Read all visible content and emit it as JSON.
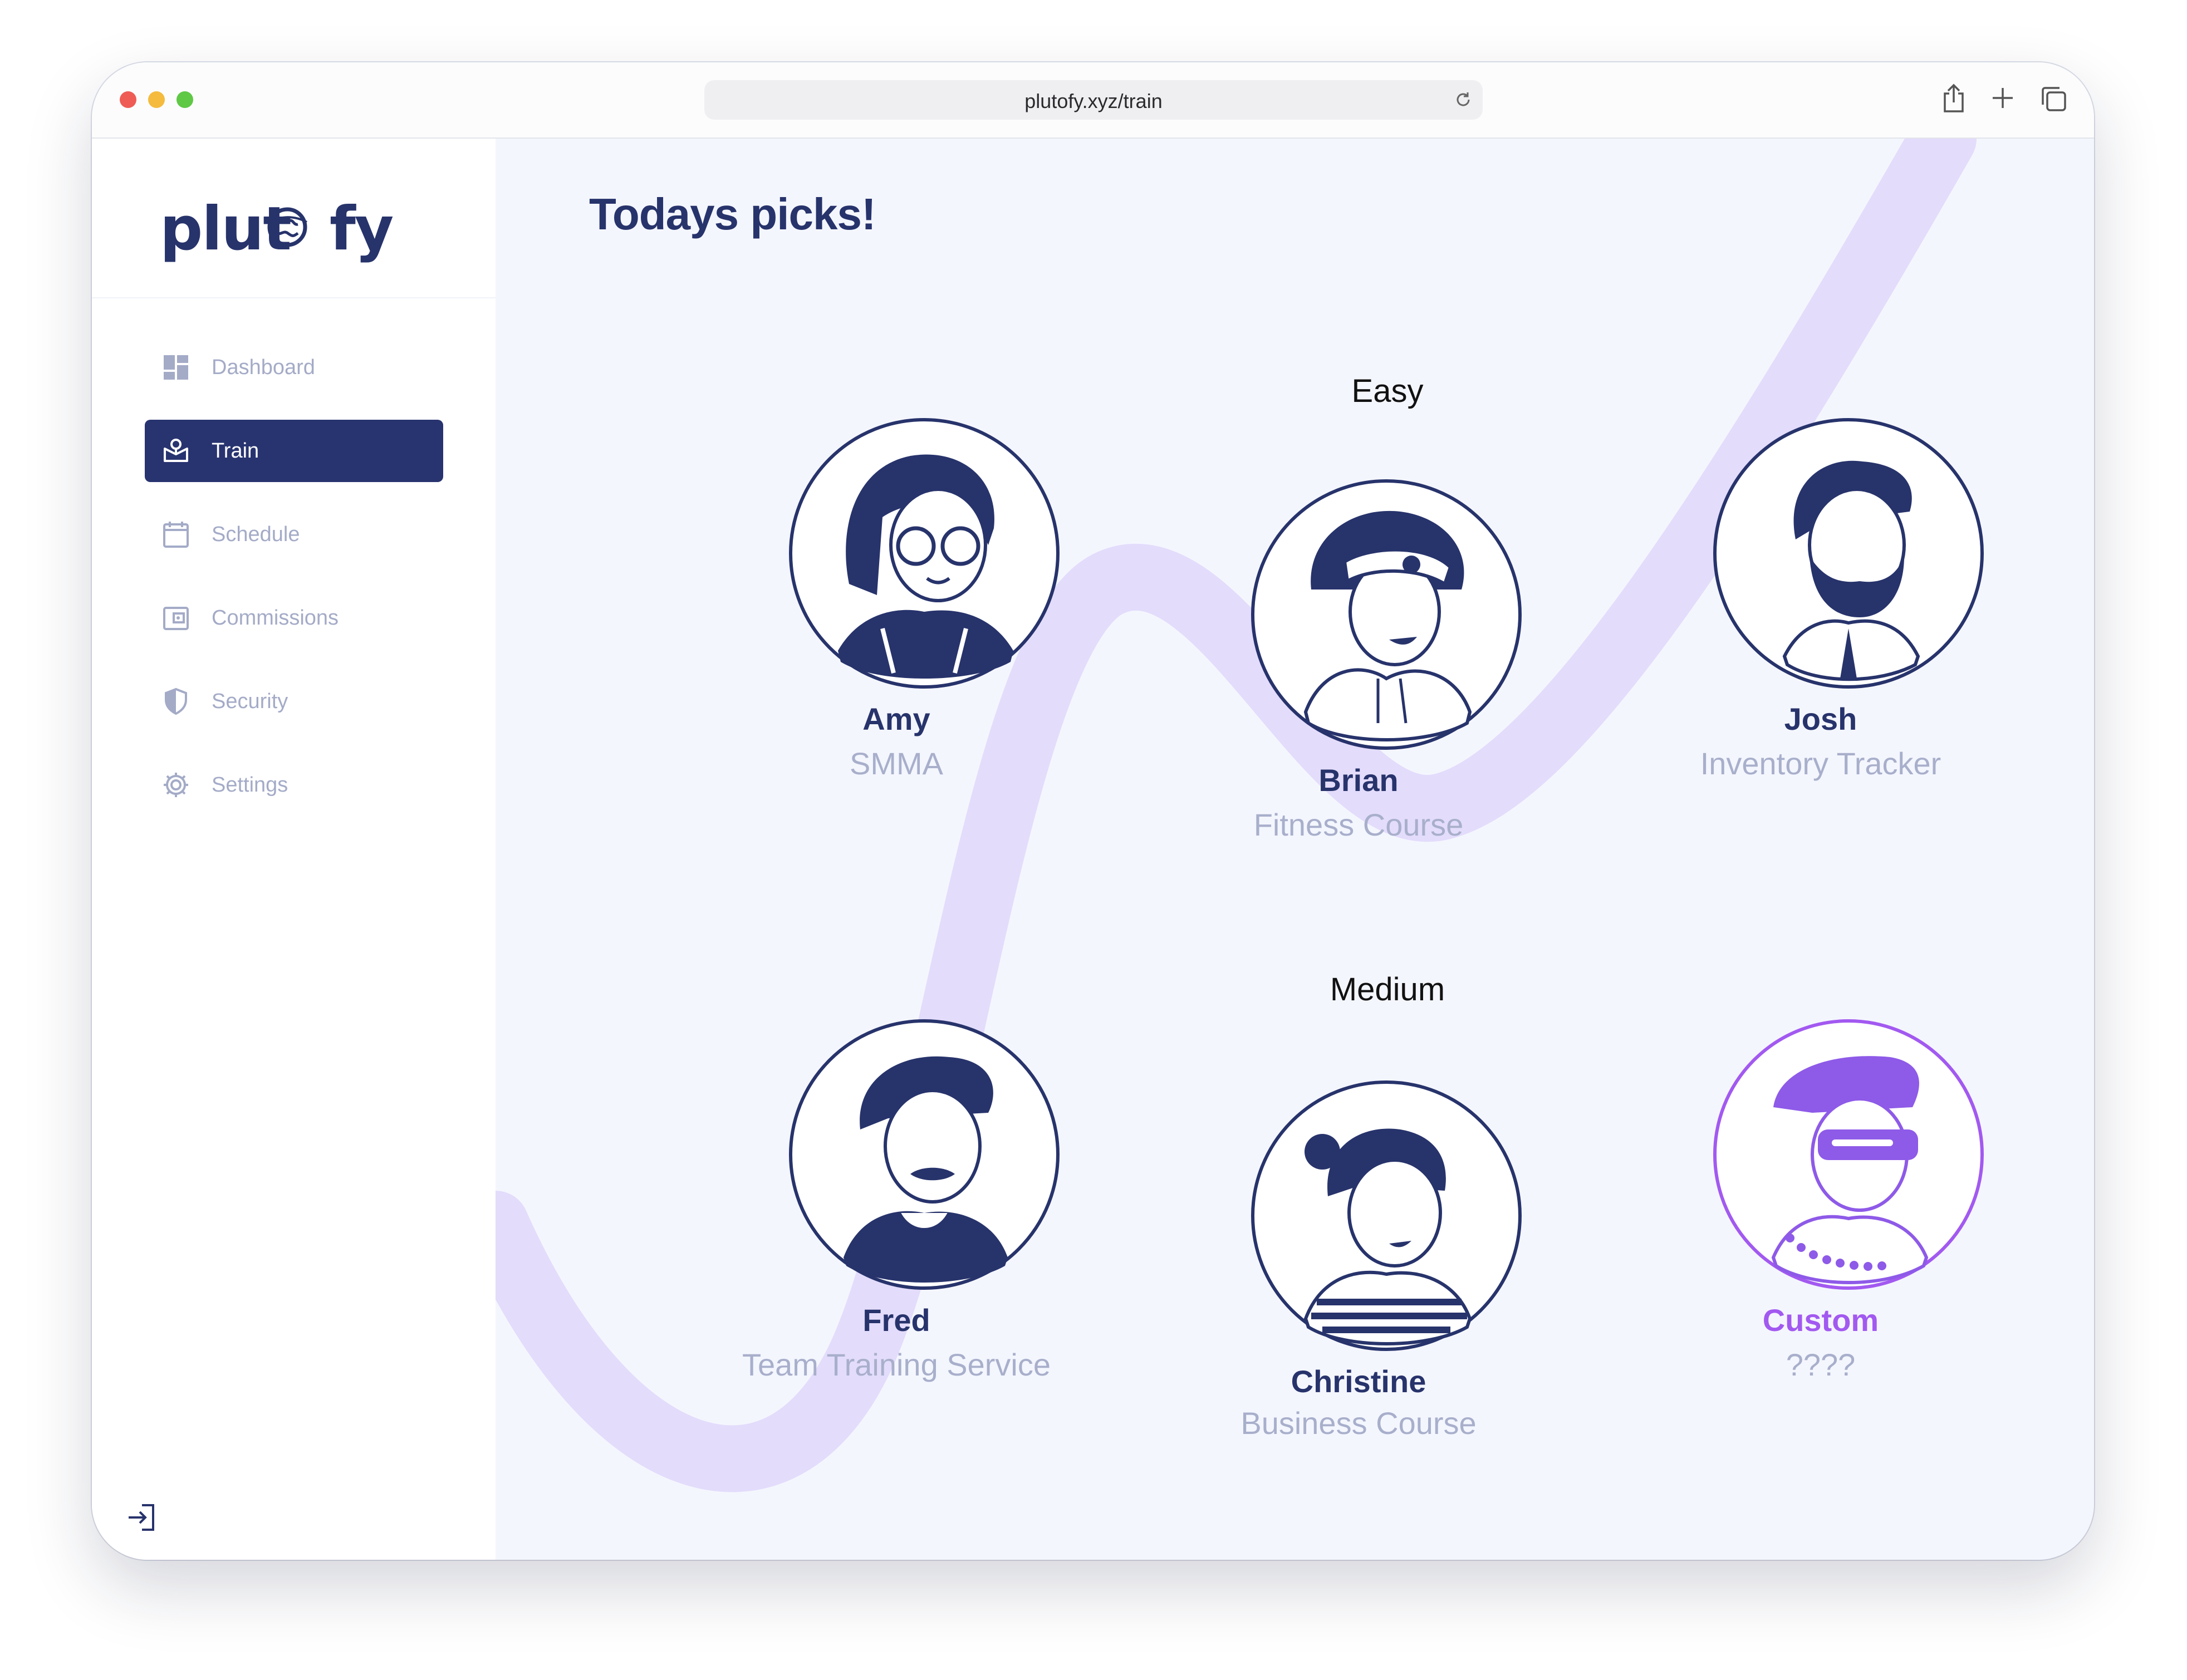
{
  "browser": {
    "url": "plutofy.xyz/train"
  },
  "sidebar": {
    "logo": "plutofy",
    "items": [
      {
        "label": "Dashboard",
        "icon": "dashboard-icon",
        "active": false
      },
      {
        "label": "Train",
        "icon": "train-icon",
        "active": true
      },
      {
        "label": "Schedule",
        "icon": "calendar-icon",
        "active": false
      },
      {
        "label": "Commissions",
        "icon": "wallet-icon",
        "active": false
      },
      {
        "label": "Security",
        "icon": "shield-icon",
        "active": false
      },
      {
        "label": "Settings",
        "icon": "gear-icon",
        "active": false
      }
    ]
  },
  "main": {
    "title": "Todays picks!",
    "groups": [
      {
        "label": "Easy",
        "picks": [
          {
            "name": "Amy",
            "topic": "SMMA"
          },
          {
            "name": "Brian",
            "topic": "Fitness Course"
          },
          {
            "name": "Josh",
            "topic": "Inventory Tracker"
          }
        ]
      },
      {
        "label": "Medium",
        "picks": [
          {
            "name": "Fred",
            "topic": "Team Training Service"
          },
          {
            "name": "Christine",
            "topic": "Business Course"
          },
          {
            "name": "Custom",
            "topic": "????"
          }
        ]
      }
    ]
  },
  "colors": {
    "brand": "#27336b",
    "accent_purple": "#a259f0",
    "muted": "#a8afcb",
    "wave": "#e3dcfb"
  }
}
